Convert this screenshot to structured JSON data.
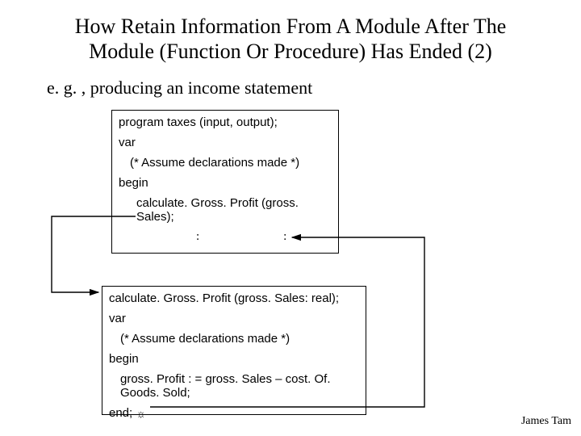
{
  "title_line1": "How Retain Information From A Module After The",
  "title_line2": "Module (Function Or Procedure) Has Ended (2)",
  "subtitle": "e. g. , producing an income statement",
  "box1": {
    "l1": "program taxes (input, output);",
    "l2": "var",
    "l3": "(* Assume declarations made *)",
    "l4": "begin",
    "l5": "calculate. Gross. Profit (gross. Sales);",
    "colon": ":"
  },
  "box2": {
    "l1": "calculate. Gross. Profit (gross. Sales: real);",
    "l2": "var",
    "l3": "(* Assume declarations made *)",
    "l4": "begin",
    "l5": "gross. Profit : = gross. Sales – cost. Of. Goods. Sold;",
    "l6": "end; ",
    "sun": "☼"
  },
  "footer": "James Tam"
}
